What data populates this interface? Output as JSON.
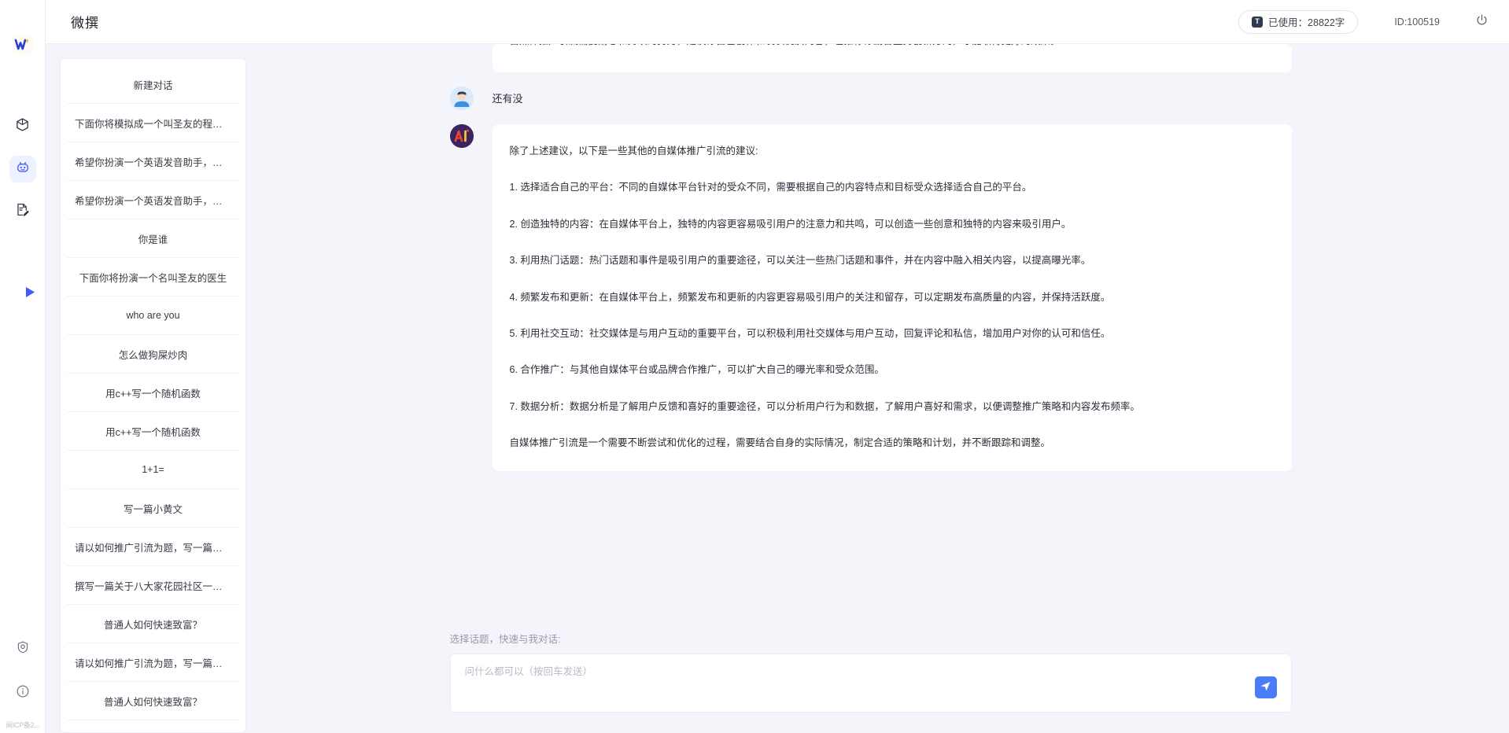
{
  "app": {
    "title": "微撰",
    "logo_icon": "w-logo-icon"
  },
  "header": {
    "usage_label": "已使用：28822字",
    "usage_icon": "text-count-icon",
    "usage_badge": "T",
    "user_id": "ID:100519",
    "power_icon": "power-icon"
  },
  "rail": {
    "items": [
      {
        "icon": "cube-icon",
        "name": "workspace",
        "active": false
      },
      {
        "icon": "robot-icon",
        "name": "ai-chat",
        "active": true
      },
      {
        "icon": "document-edit-icon",
        "name": "documents",
        "active": false
      }
    ],
    "toggle_icon": "expand-arrow-icon",
    "bottom_items": [
      {
        "icon": "shield-icon",
        "name": "security"
      },
      {
        "icon": "info-icon",
        "name": "about"
      }
    ],
    "icp": "闽ICP备2..."
  },
  "conversations": {
    "new_chat_label": "新建对话",
    "items": [
      "下面你将模拟成一个叫圣友的程序员，我说...",
      "希望你扮演一个英语发音助手，我提供给你...",
      "希望你扮演一个英语发音助手，我提供给你...",
      "你是谁",
      "下面你将扮演一个名叫圣友的医生",
      "who are you",
      "怎么做狗屎炒肉",
      "用c++写一个随机函数",
      "用c++写一个随机函数",
      "1+1=",
      "写一篇小黄文",
      "请以如何推广引流为题，写一篇大纲",
      "撰写一篇关于八大家花园社区一刻钟便民生...",
      "普通人如何快速致富？",
      "请以如何推广引流为题，写一篇大纲",
      "普通人如何快速致富？"
    ]
  },
  "chat": {
    "clipped_message": "自媒体推广引流需要耐心和持续的努力，建议你自己创作和发表优质内容，也推荐你勤奋坚持创新方向，才能取得更好的效果。",
    "user_message": "还有没",
    "user_avatar_icon": "user-avatar-icon",
    "ai_avatar_icon": "ai-avatar-icon",
    "ai_paragraphs": [
      "除了上述建议，以下是一些其他的自媒体推广引流的建议:",
      "1. 选择适合自己的平台：不同的自媒体平台针对的受众不同，需要根据自己的内容特点和目标受众选择适合自己的平台。",
      "2. 创造独特的内容：在自媒体平台上，独特的内容更容易吸引用户的注意力和共鸣，可以创造一些创意和独特的内容来吸引用户。",
      "3. 利用热门话题：热门话题和事件是吸引用户的重要途径，可以关注一些热门话题和事件，并在内容中融入相关内容，以提高曝光率。",
      "4. 频繁发布和更新：在自媒体平台上，频繁发布和更新的内容更容易吸引用户的关注和留存，可以定期发布高质量的内容，并保持活跃度。",
      "5. 利用社交互动：社交媒体是与用户互动的重要平台，可以积极利用社交媒体与用户互动，回复评论和私信，增加用户对你的认可和信任。",
      "6. 合作推广：与其他自媒体平台或品牌合作推广，可以扩大自己的曝光率和受众范围。",
      "7. 数据分析：数据分析是了解用户反馈和喜好的重要途径，可以分析用户行为和数据，了解用户喜好和需求，以便调整推广策略和内容发布频率。",
      "自媒体推广引流是一个需要不断尝试和优化的过程，需要结合自身的实际情况，制定合适的策略和计划，并不断跟踪和调整。"
    ]
  },
  "composer": {
    "hint": "选择话题，快速与我对话:",
    "placeholder": "问什么都可以（按回车发送）",
    "value": "",
    "send_icon": "send-icon"
  },
  "colors": {
    "accent": "#3b5bfd",
    "send_button": "#4a7cf7",
    "page_bg": "#f4f4fb",
    "card_bg": "#ffffff"
  }
}
